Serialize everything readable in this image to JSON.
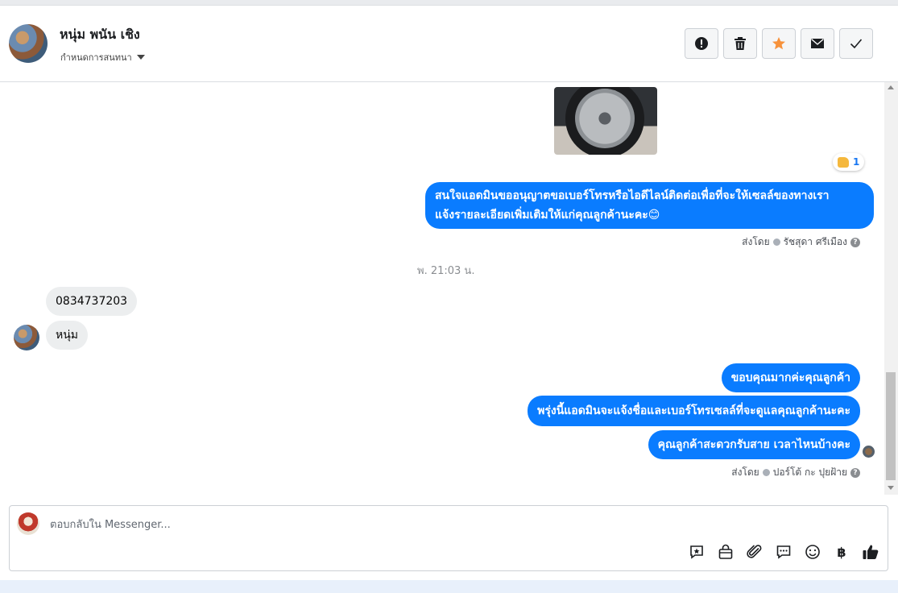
{
  "header": {
    "contact_name": "หนุ่ม พนัน เชิง",
    "assign_label": "กำหนดการสนทนา",
    "actions": [
      "spam-icon",
      "trash-icon",
      "star-icon",
      "envelope-icon",
      "check-icon"
    ],
    "star_color": "#f7923b"
  },
  "chat": {
    "reaction_count": "1",
    "messages_out_1": {
      "line1": "สนใจแอดมินขออนุญาตขอเบอร์โทรหรือไอดีไลน์ติดต่อเพื่อที่จะให้เซลล์ของทางเรา",
      "line2": "แจ้งรายละเอียดเพิ่มเติมให้แก่คุณลูกค้านะคะ😊"
    },
    "sent_by_1": {
      "prefix": "ส่งโดย",
      "name": "รัชสุดา ศรีเมือง"
    },
    "timestamp": "พ. 21:03 น.",
    "messages_in": [
      "0834737203",
      "หนุ่ม"
    ],
    "messages_out_2": [
      "ขอบคุณมากค่ะคุณลูกค้า",
      "พรุ่งนี้แอดมินจะแจ้งชื่อและเบอร์โทรเซลล์ที่จะดูแลคุณลูกค้านะคะ",
      "คุณลูกค้าสะดวกรับสาย เวลาไหนบ้างคะ"
    ],
    "sent_by_2": {
      "prefix": "ส่งโดย",
      "name": "ปอร์โต้ กะ ปุยฝ้าย"
    },
    "bubble_color": "#0a7cff"
  },
  "composer": {
    "placeholder": "ตอบกลับใน Messenger...",
    "tools": [
      "saved-reply-icon",
      "shop-bag-icon",
      "attachment-icon",
      "chat-bubbles-icon",
      "emoji-icon",
      "baht-icon",
      "like-icon"
    ],
    "baht_symbol": "฿"
  }
}
